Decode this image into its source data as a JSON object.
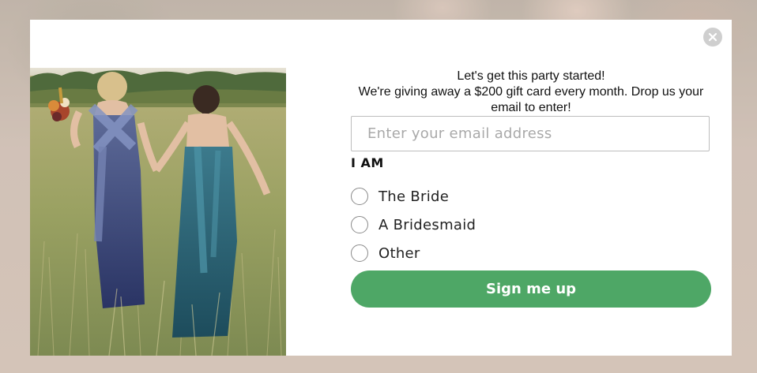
{
  "popup": {
    "headline": "Let's get this party started!",
    "subline": "We're giving away a $200 gift card every month. Drop us your email to enter!",
    "email_placeholder": "Enter your email address",
    "email_value": "",
    "iam_label": "I AM",
    "options": [
      {
        "label": "The Bride",
        "selected": false
      },
      {
        "label": "A Bridesmaid",
        "selected": false
      },
      {
        "label": "Other",
        "selected": false
      }
    ],
    "submit_label": "Sign me up",
    "close_icon": "close-icon",
    "colors": {
      "accent": "#4ea766",
      "close_bg": "#cfcfcf"
    }
  },
  "image": {
    "subject": "photo"
  }
}
